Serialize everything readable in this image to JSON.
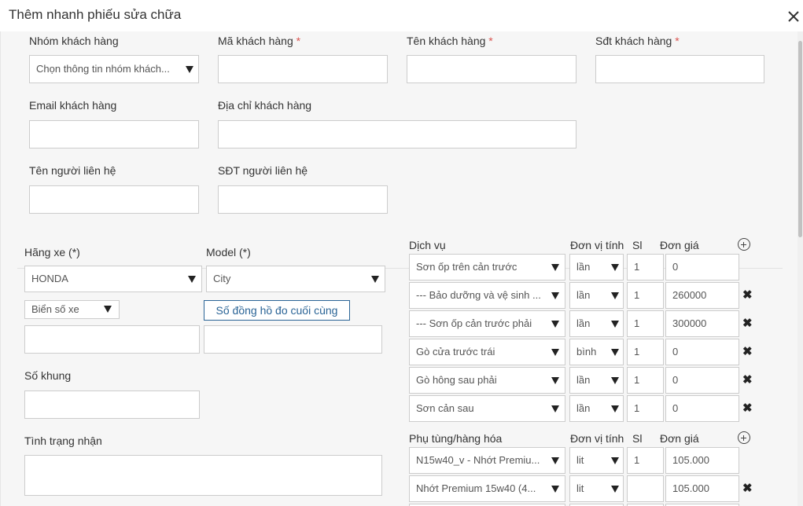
{
  "modal": {
    "title": "Thêm nhanh phiếu sửa chữa"
  },
  "customer": {
    "group_label": "Nhóm khách hàng",
    "group_value": "Chọn thông tin nhóm khách...",
    "code_label": "Mã khách hàng",
    "name_label": "Tên khách hàng",
    "phone_label": "Sđt khách hàng",
    "email_label": "Email khách hàng",
    "address_label": "Địa chỉ khách hàng",
    "contact_name_label": "Tên người liên hệ",
    "contact_phone_label": "SĐT người liên hệ",
    "required_mark": "*"
  },
  "vehicle": {
    "brand_label": "Hãng xe (*)",
    "brand_value": "HONDA",
    "model_label": "Model (*)",
    "model_value": "City",
    "plate_select": "Biển số xe",
    "odometer_button": "Số đồng hồ đo cuối cùng",
    "chassis_label": "Số khung",
    "condition_label": "Tình trạng nhận"
  },
  "services": {
    "header": {
      "service": "Dịch vụ",
      "unit": "Đơn vị tính",
      "qty": "Sl",
      "price": "Đơn giá"
    },
    "rows": [
      {
        "name": "Sơn ốp trên cản trước",
        "unit": "lần",
        "qty": "1",
        "price": "0"
      },
      {
        "name": "--- Bảo dưỡng và vệ sinh ...",
        "unit": "lần",
        "qty": "1",
        "price": "260000"
      },
      {
        "name": "--- Sơn ốp cản trước phải",
        "unit": "lần",
        "qty": "1",
        "price": "300000"
      },
      {
        "name": "Gò cửa trước trái",
        "unit": "bình",
        "qty": "1",
        "price": "0"
      },
      {
        "name": "Gò hông sau phải",
        "unit": "lần",
        "qty": "1",
        "price": "0"
      },
      {
        "name": "Sơn cản sau",
        "unit": "lần",
        "qty": "1",
        "price": "0"
      }
    ]
  },
  "parts": {
    "header": {
      "part": "Phụ tùng/hàng hóa",
      "unit": "Đơn vị tính",
      "qty": "Sl",
      "price": "Đơn giá"
    },
    "rows": [
      {
        "name": "N15w40_v - Nhớt Premiu...",
        "unit": "lit",
        "qty": "1",
        "price": "105.000"
      },
      {
        "name": "Nhớt Premium 15w40 (4...",
        "unit": "lit",
        "qty": "",
        "price": "105.000"
      }
    ]
  },
  "icons": {
    "close": "close-icon",
    "add": "plus-circle-icon",
    "delete": "x-delete-icon",
    "caret": "caret-down-icon"
  }
}
